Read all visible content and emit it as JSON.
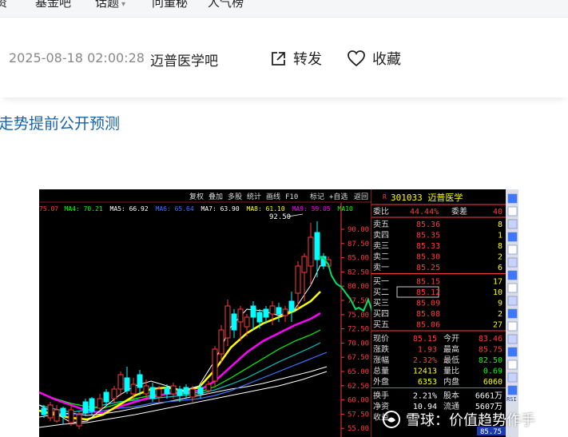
{
  "nav": {
    "items": [
      {
        "label": "资"
      },
      {
        "label": "基金吧",
        "has_chevron": false
      },
      {
        "label": "话题",
        "has_chevron": true
      },
      {
        "label": "问董秘"
      },
      {
        "label": "人气榜"
      }
    ]
  },
  "post": {
    "timestamp": "2025-08-18 02:00:28",
    "forum": "迈普医学吧",
    "share_label": "转发",
    "favorite_label": "收藏",
    "title": "走势提前公开预测"
  },
  "chart_image": {
    "toolbar": [
      "复权",
      "叠加",
      "多股",
      "统计",
      "画线",
      "F10",
      "标记",
      "+自选",
      "返回"
    ],
    "ma_labels": [
      {
        "text": "75.07",
        "color": "#ff3c3c"
      },
      {
        "text": "MA4: 70.21",
        "color": "#00ff00"
      },
      {
        "text": "MA5: 66.92",
        "color": "#ffffff"
      },
      {
        "text": "MA6: 65.64",
        "color": "#3c78ff"
      },
      {
        "text": "MA7: 63.90",
        "color": "#ffffff"
      },
      {
        "text": "MA8: 61.10",
        "color": "#ffff00"
      },
      {
        "text": "MA9: 59.05",
        "color": "#ff00ff"
      },
      {
        "text": "MA10",
        "color": "#00ff00"
      }
    ],
    "peak_label": "92.50",
    "price_axis": [
      "90.00",
      "87.50",
      "85.00",
      "82.50",
      "80.00",
      "77.50",
      "75.00",
      "72.50",
      "70.00",
      "67.50",
      "65.00",
      "62.50",
      "60.00",
      "57.50",
      "55.00"
    ],
    "quote": {
      "code": "301033",
      "name": "迈普医学",
      "wei_bi_label": "委比",
      "wei_bi": "44.44%",
      "wei_cha_label": "委差",
      "wei_cha": "40",
      "asks": [
        {
          "label": "卖五",
          "price": "85.36",
          "vol": "8"
        },
        {
          "label": "卖四",
          "price": "85.35",
          "vol": "1"
        },
        {
          "label": "卖三",
          "price": "85.33",
          "vol": "8"
        },
        {
          "label": "卖二",
          "price": "85.30",
          "vol": "2"
        },
        {
          "label": "卖一",
          "price": "85.25",
          "vol": "6"
        }
      ],
      "bids": [
        {
          "label": "买一",
          "price": "85.15",
          "vol": "17"
        },
        {
          "label": "买二",
          "price": "85.12",
          "vol": "10"
        },
        {
          "label": "买三",
          "price": "85.09",
          "vol": "9"
        },
        {
          "label": "买四",
          "price": "85.08",
          "vol": "2"
        },
        {
          "label": "买五",
          "price": "85.06",
          "vol": "27"
        }
      ],
      "stats": [
        {
          "l1": "现价",
          "v1": "85.15",
          "l2": "今开",
          "v2": "83.46"
        },
        {
          "l1": "涨跌",
          "v1": "1.93",
          "l2": "最高",
          "v2": "85.75"
        },
        {
          "l1": "涨幅",
          "v1": "2.32%",
          "l2": "最低",
          "v2": "82.50"
        },
        {
          "l1": "总量",
          "v1": "12413",
          "l2": "量比",
          "v2": "0.69"
        },
        {
          "l1": "外盘",
          "v1": "6353",
          "l2": "内盘",
          "v2": "6060"
        }
      ],
      "extra": [
        {
          "l1": "换手",
          "v1": "2.21%",
          "l2": "股本",
          "v2": "6661万"
        },
        {
          "l1": "净资",
          "v1": "10.94",
          "l2": "流通",
          "v2": "5607万"
        },
        {
          "l1": "收益",
          "v1": "",
          "l2": "",
          "v2": ""
        }
      ],
      "bottom_price": "85.75"
    },
    "side_tools": [
      "RSI"
    ]
  },
  "watermark": {
    "text": "雪球：价值趋势作手"
  },
  "colors": {
    "link": "#1661ab",
    "chart_bg": "#000000",
    "up": "#ff3c3c",
    "down": "#00ffff",
    "axis": "#ff3c3c"
  }
}
